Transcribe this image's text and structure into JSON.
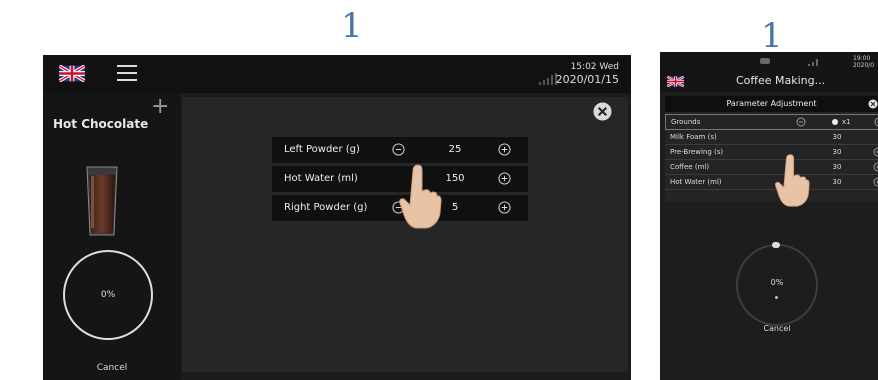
{
  "step_labels": [
    "1",
    "1"
  ],
  "screen1": {
    "time": "15:02 Wed",
    "date": "2020/01/15",
    "product": "Hot Chocolate",
    "progress": "0%",
    "cancel": "Cancel",
    "params": [
      {
        "label": "Left Powder (g)",
        "value": "25"
      },
      {
        "label": "Hot Water (ml)",
        "value": "150"
      },
      {
        "label": "Right Powder (g)",
        "value": "5"
      }
    ]
  },
  "screen2": {
    "time": "19:00",
    "date": "2020/0",
    "title": "Coffee Making...",
    "panel_title": "Parameter Adjustment",
    "params": [
      {
        "label": "Grounds",
        "value": "x1"
      },
      {
        "label": "Milk Foam (s)",
        "value": "30"
      },
      {
        "label": "Pre-Brewing (s)",
        "value": "30"
      },
      {
        "label": "Coffee (ml)",
        "value": "30"
      },
      {
        "label": "Hot Water (ml)",
        "value": "30"
      }
    ],
    "progress": "0%",
    "cancel": "Cancel"
  },
  "icons": [
    "uk-flag-icon",
    "hamburger-menu-icon",
    "signal-icon",
    "plus-icon",
    "glass-cup-icon",
    "close-icon",
    "minus-icon",
    "plus-circle-icon",
    "pointing-hand-icon",
    "wifi-icon"
  ],
  "colors": {
    "screen_bg": "#1c1c1c",
    "panel_bg": "#262626",
    "row_bg": "#101010",
    "step_label": "#4a74a8"
  }
}
